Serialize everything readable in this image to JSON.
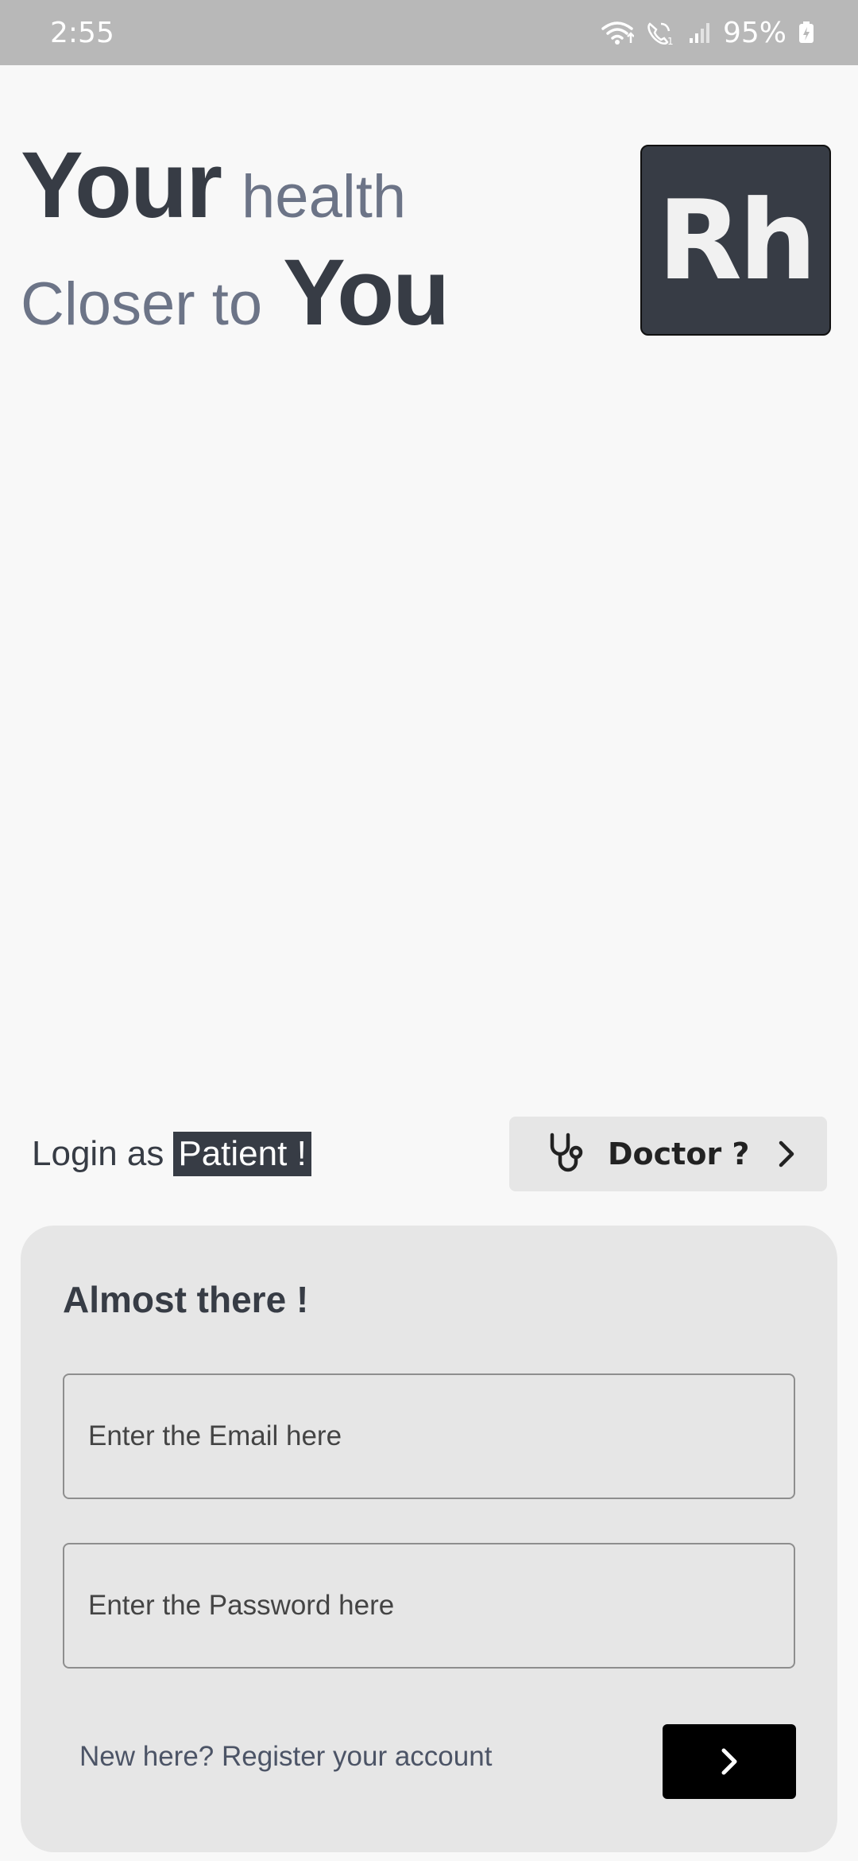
{
  "status_bar": {
    "time": "2:55",
    "battery": "95%",
    "icons": [
      "wifi-icon",
      "wifi-calling-icon",
      "signal-icon",
      "battery-charging-icon"
    ]
  },
  "hero": {
    "line1_bold": "Your",
    "line1_light": "health",
    "line2_light": "Closer to",
    "line2_bold": "You"
  },
  "logo": {
    "text": "Rh"
  },
  "login": {
    "prefix": "Login as",
    "role": "Patient !"
  },
  "doctor_button": {
    "label": "Doctor ?",
    "icon": "stethoscope-icon"
  },
  "card": {
    "title": "Almost there !",
    "email_placeholder": "Enter the Email here",
    "password_placeholder": "Enter the Password here",
    "register_text": "New here? Register your account",
    "submit_icon": "chevron-right-icon"
  },
  "colors": {
    "background": "#f8f8f8",
    "primary_dark": "#373c45",
    "muted": "#6c7487",
    "card": "#e6e6e6",
    "status_bar": "#b8b8b8"
  }
}
